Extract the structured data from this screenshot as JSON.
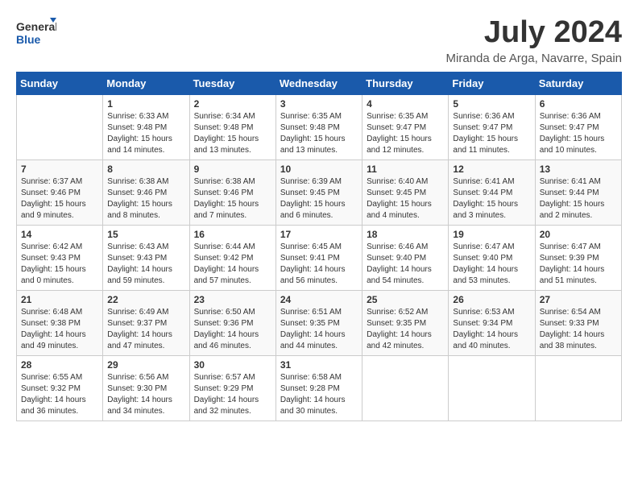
{
  "header": {
    "logo_general": "General",
    "logo_blue": "Blue",
    "month_year": "July 2024",
    "location": "Miranda de Arga, Navarre, Spain"
  },
  "weekdays": [
    "Sunday",
    "Monday",
    "Tuesday",
    "Wednesday",
    "Thursday",
    "Friday",
    "Saturday"
  ],
  "weeks": [
    [
      {
        "day": "",
        "sunrise": "",
        "sunset": "",
        "daylight": ""
      },
      {
        "day": "1",
        "sunrise": "Sunrise: 6:33 AM",
        "sunset": "Sunset: 9:48 PM",
        "daylight": "Daylight: 15 hours and 14 minutes."
      },
      {
        "day": "2",
        "sunrise": "Sunrise: 6:34 AM",
        "sunset": "Sunset: 9:48 PM",
        "daylight": "Daylight: 15 hours and 13 minutes."
      },
      {
        "day": "3",
        "sunrise": "Sunrise: 6:35 AM",
        "sunset": "Sunset: 9:48 PM",
        "daylight": "Daylight: 15 hours and 13 minutes."
      },
      {
        "day": "4",
        "sunrise": "Sunrise: 6:35 AM",
        "sunset": "Sunset: 9:47 PM",
        "daylight": "Daylight: 15 hours and 12 minutes."
      },
      {
        "day": "5",
        "sunrise": "Sunrise: 6:36 AM",
        "sunset": "Sunset: 9:47 PM",
        "daylight": "Daylight: 15 hours and 11 minutes."
      },
      {
        "day": "6",
        "sunrise": "Sunrise: 6:36 AM",
        "sunset": "Sunset: 9:47 PM",
        "daylight": "Daylight: 15 hours and 10 minutes."
      }
    ],
    [
      {
        "day": "7",
        "sunrise": "Sunrise: 6:37 AM",
        "sunset": "Sunset: 9:46 PM",
        "daylight": "Daylight: 15 hours and 9 minutes."
      },
      {
        "day": "8",
        "sunrise": "Sunrise: 6:38 AM",
        "sunset": "Sunset: 9:46 PM",
        "daylight": "Daylight: 15 hours and 8 minutes."
      },
      {
        "day": "9",
        "sunrise": "Sunrise: 6:38 AM",
        "sunset": "Sunset: 9:46 PM",
        "daylight": "Daylight: 15 hours and 7 minutes."
      },
      {
        "day": "10",
        "sunrise": "Sunrise: 6:39 AM",
        "sunset": "Sunset: 9:45 PM",
        "daylight": "Daylight: 15 hours and 6 minutes."
      },
      {
        "day": "11",
        "sunrise": "Sunrise: 6:40 AM",
        "sunset": "Sunset: 9:45 PM",
        "daylight": "Daylight: 15 hours and 4 minutes."
      },
      {
        "day": "12",
        "sunrise": "Sunrise: 6:41 AM",
        "sunset": "Sunset: 9:44 PM",
        "daylight": "Daylight: 15 hours and 3 minutes."
      },
      {
        "day": "13",
        "sunrise": "Sunrise: 6:41 AM",
        "sunset": "Sunset: 9:44 PM",
        "daylight": "Daylight: 15 hours and 2 minutes."
      }
    ],
    [
      {
        "day": "14",
        "sunrise": "Sunrise: 6:42 AM",
        "sunset": "Sunset: 9:43 PM",
        "daylight": "Daylight: 15 hours and 0 minutes."
      },
      {
        "day": "15",
        "sunrise": "Sunrise: 6:43 AM",
        "sunset": "Sunset: 9:43 PM",
        "daylight": "Daylight: 14 hours and 59 minutes."
      },
      {
        "day": "16",
        "sunrise": "Sunrise: 6:44 AM",
        "sunset": "Sunset: 9:42 PM",
        "daylight": "Daylight: 14 hours and 57 minutes."
      },
      {
        "day": "17",
        "sunrise": "Sunrise: 6:45 AM",
        "sunset": "Sunset: 9:41 PM",
        "daylight": "Daylight: 14 hours and 56 minutes."
      },
      {
        "day": "18",
        "sunrise": "Sunrise: 6:46 AM",
        "sunset": "Sunset: 9:40 PM",
        "daylight": "Daylight: 14 hours and 54 minutes."
      },
      {
        "day": "19",
        "sunrise": "Sunrise: 6:47 AM",
        "sunset": "Sunset: 9:40 PM",
        "daylight": "Daylight: 14 hours and 53 minutes."
      },
      {
        "day": "20",
        "sunrise": "Sunrise: 6:47 AM",
        "sunset": "Sunset: 9:39 PM",
        "daylight": "Daylight: 14 hours and 51 minutes."
      }
    ],
    [
      {
        "day": "21",
        "sunrise": "Sunrise: 6:48 AM",
        "sunset": "Sunset: 9:38 PM",
        "daylight": "Daylight: 14 hours and 49 minutes."
      },
      {
        "day": "22",
        "sunrise": "Sunrise: 6:49 AM",
        "sunset": "Sunset: 9:37 PM",
        "daylight": "Daylight: 14 hours and 47 minutes."
      },
      {
        "day": "23",
        "sunrise": "Sunrise: 6:50 AM",
        "sunset": "Sunset: 9:36 PM",
        "daylight": "Daylight: 14 hours and 46 minutes."
      },
      {
        "day": "24",
        "sunrise": "Sunrise: 6:51 AM",
        "sunset": "Sunset: 9:35 PM",
        "daylight": "Daylight: 14 hours and 44 minutes."
      },
      {
        "day": "25",
        "sunrise": "Sunrise: 6:52 AM",
        "sunset": "Sunset: 9:35 PM",
        "daylight": "Daylight: 14 hours and 42 minutes."
      },
      {
        "day": "26",
        "sunrise": "Sunrise: 6:53 AM",
        "sunset": "Sunset: 9:34 PM",
        "daylight": "Daylight: 14 hours and 40 minutes."
      },
      {
        "day": "27",
        "sunrise": "Sunrise: 6:54 AM",
        "sunset": "Sunset: 9:33 PM",
        "daylight": "Daylight: 14 hours and 38 minutes."
      }
    ],
    [
      {
        "day": "28",
        "sunrise": "Sunrise: 6:55 AM",
        "sunset": "Sunset: 9:32 PM",
        "daylight": "Daylight: 14 hours and 36 minutes."
      },
      {
        "day": "29",
        "sunrise": "Sunrise: 6:56 AM",
        "sunset": "Sunset: 9:30 PM",
        "daylight": "Daylight: 14 hours and 34 minutes."
      },
      {
        "day": "30",
        "sunrise": "Sunrise: 6:57 AM",
        "sunset": "Sunset: 9:29 PM",
        "daylight": "Daylight: 14 hours and 32 minutes."
      },
      {
        "day": "31",
        "sunrise": "Sunrise: 6:58 AM",
        "sunset": "Sunset: 9:28 PM",
        "daylight": "Daylight: 14 hours and 30 minutes."
      },
      {
        "day": "",
        "sunrise": "",
        "sunset": "",
        "daylight": ""
      },
      {
        "day": "",
        "sunrise": "",
        "sunset": "",
        "daylight": ""
      },
      {
        "day": "",
        "sunrise": "",
        "sunset": "",
        "daylight": ""
      }
    ]
  ]
}
